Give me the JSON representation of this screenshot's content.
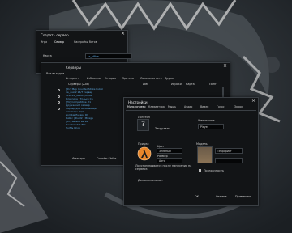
{
  "background": {
    "scene": "dark-game-wallpaper"
  },
  "create_server": {
    "title": "Создать сервер",
    "tabs": [
      "Игра",
      "Сервер",
      "Настройки ботов"
    ],
    "map_label": "Карта",
    "map_value": "cs_office",
    "confirm_label": "Начать"
  },
  "servers": {
    "title": "Серверы",
    "tabs": [
      "Интернет",
      "Избранное",
      "История",
      "Зритель",
      "Локальная сеть",
      "Друзья"
    ],
    "left_label": "Все вкладки",
    "list_header": "Серверы (228)",
    "columns": [
      "Имя",
      "Игроки",
      "Карта",
      "Пинг"
    ],
    "rows": [
      "[RU] Мир Counter-Strike Public",
      "de_dust2 24/7 сервер",
      "SERVER_NAME_LONG",
      "Классика | Только CS",
      "[EU] Competitive #1",
      "Дружеский сервер",
      "Сервер для начинающих",
      "Aim maps 24/7",
      "Zombie Escape RU",
      "Public | Dust2 | Mirage",
      "[RU] Retake server",
      "Deathmatch FFA",
      "Surf & Bhop"
    ],
    "filters_label": "Фильтры",
    "game_label": "Counter-Strike",
    "change_filters": "Изменить фильтры",
    "refresh_label": "Обновить"
  },
  "options": {
    "title": "Настройки",
    "tabs": [
      "Мультиплеер",
      "Клавиатура",
      "Мышь",
      "Аудио",
      "Видео",
      "Голос",
      "Замок"
    ],
    "spray_label": "Логотип",
    "import_label": "Загрузить...",
    "player_name_label": "Имя игрока",
    "player_name_value": "Player",
    "crosshair_label": "Прицел",
    "color_label": "Цвет",
    "color_value": "Зеленый",
    "size_label": "Размер",
    "size_value": "Авто",
    "model_label": "Модель",
    "model_value": "Террорист",
    "note": "Логотип появится после нанесения на сервере.",
    "transparency_label": "Прозрачность",
    "advanced_label": "Дополнительно...",
    "ok_label": "ОК",
    "cancel_label": "Отмена",
    "apply_label": "Применить"
  }
}
